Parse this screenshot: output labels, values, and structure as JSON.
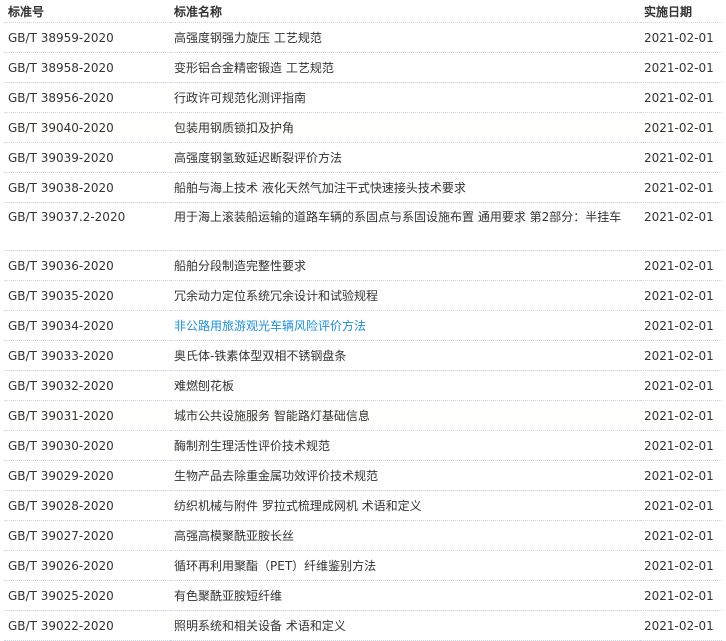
{
  "table": {
    "headers": {
      "number": "标准号",
      "name": "标准名称",
      "date": "实施日期"
    },
    "accent_color": "#1e90d8",
    "rows": [
      {
        "number": "GB/T 38959-2020",
        "name": "高强度钢强力旋压 工艺规范",
        "date": "2021-02-01"
      },
      {
        "number": "GB/T 38958-2020",
        "name": "变形铝合金精密锻造 工艺规范",
        "date": "2021-02-01"
      },
      {
        "number": "GB/T 38956-2020",
        "name": "行政许可规范化测评指南",
        "date": "2021-02-01"
      },
      {
        "number": "GB/T 39040-2020",
        "name": "包装用钢质锁扣及护角",
        "date": "2021-02-01"
      },
      {
        "number": "GB/T 39039-2020",
        "name": "高强度钢氢致延迟断裂评价方法",
        "date": "2021-02-01"
      },
      {
        "number": "GB/T 39038-2020",
        "name": "船舶与海上技术 液化天然气加注干式快速接头技术要求",
        "date": "2021-02-01"
      },
      {
        "number": "GB/T 39037.2-2020",
        "name": "用于海上滚装船运输的道路车辆的系固点与系固设施布置 通用要求 第2部分：半挂车",
        "date": "2021-02-01"
      },
      {
        "number": "GB/T 39036-2020",
        "name": "船舶分段制造完整性要求",
        "date": "2021-02-01"
      },
      {
        "number": "GB/T 39035-2020",
        "name": "冗余动力定位系统冗余设计和试验规程",
        "date": "2021-02-01"
      },
      {
        "number": "GB/T 39034-2020",
        "name": "非公路用旅游观光车辆风险评价方法",
        "date": "2021-02-01",
        "active": true
      },
      {
        "number": "GB/T 39033-2020",
        "name": "奥氏体-铁素体型双相不锈钢盘条",
        "date": "2021-02-01"
      },
      {
        "number": "GB/T 39032-2020",
        "name": "难燃刨花板",
        "date": "2021-02-01"
      },
      {
        "number": "GB/T 39031-2020",
        "name": "城市公共设施服务 智能路灯基础信息",
        "date": "2021-02-01"
      },
      {
        "number": "GB/T 39030-2020",
        "name": "酶制剂生理活性评价技术规范",
        "date": "2021-02-01"
      },
      {
        "number": "GB/T 39029-2020",
        "name": "生物产品去除重金属功效评价技术规范",
        "date": "2021-02-01"
      },
      {
        "number": "GB/T 39028-2020",
        "name": "纺织机械与附件 罗拉式梳理成网机 术语和定义",
        "date": "2021-02-01"
      },
      {
        "number": "GB/T 39027-2020",
        "name": "高强高模聚酰亚胺长丝",
        "date": "2021-02-01"
      },
      {
        "number": "GB/T 39026-2020",
        "name": "循环再利用聚酯（PET）纤维鉴别方法",
        "date": "2021-02-01"
      },
      {
        "number": "GB/T 39025-2020",
        "name": "有色聚酰亚胺短纤维",
        "date": "2021-02-01"
      },
      {
        "number": "GB/T 39022-2020",
        "name": "照明系统和相关设备 术语和定义",
        "date": "2021-02-01"
      }
    ]
  }
}
